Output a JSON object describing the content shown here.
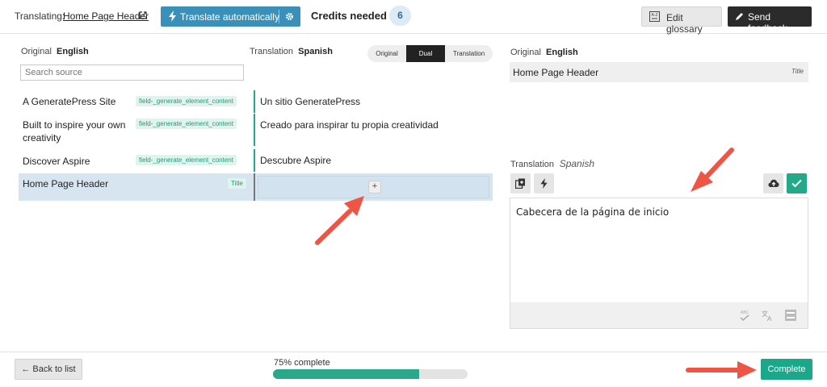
{
  "header": {
    "translating_label": "Translating:",
    "page_link": "Home Page Header",
    "translate_auto_label": "Translate automatically",
    "credits_label": "Credits needed",
    "credits_value": "6",
    "edit_glossary_label": "Edit glossary",
    "send_feedback_label": "Send feedback"
  },
  "list": {
    "original_label": "Original",
    "original_lang": "English",
    "translation_label": "Translation",
    "translation_lang": "Spanish",
    "view_modes": [
      "Original",
      "Dual",
      "Translation"
    ],
    "active_view": "Dual",
    "search_placeholder": "Search source",
    "rows": [
      {
        "source": "A GeneratePress Site",
        "tag": "field-_generate_element_content",
        "translation": "Un sitio GeneratePress"
      },
      {
        "source": "Built to inspire your own creativity",
        "tag": "field-_generate_element_content",
        "translation": "Creado para inspirar tu propia creatividad"
      },
      {
        "source": "Discover Aspire",
        "tag": "field-_generate_element_content",
        "translation": "Descubre Aspire"
      },
      {
        "source": "Home Page Header",
        "tag": "Title",
        "translation": "+"
      }
    ]
  },
  "editor": {
    "original_label": "Original",
    "original_lang": "English",
    "original_text": "Home Page Header",
    "original_type": "Title",
    "translation_label": "Translation",
    "translation_lang": "Spanish",
    "translation_text": "Cabecera de la página de inicio"
  },
  "footer": {
    "back_label": "← Back to list",
    "progress_label": "75% complete",
    "progress_percent": 75,
    "complete_label": "Complete"
  },
  "colors": {
    "accent_teal": "#1ba88a",
    "accent_blue": "#3a90b8",
    "arrow": "#ee5544"
  }
}
